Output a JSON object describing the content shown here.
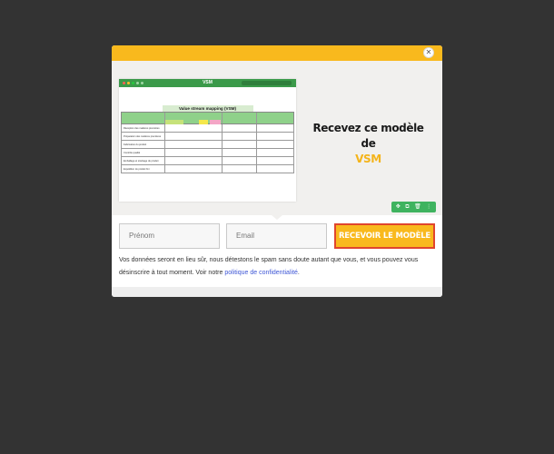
{
  "modal": {
    "close_symbol": "✕",
    "headline": "Recevez ce modèle de",
    "headline_accent": "VSM",
    "accent_color": "#f9b91d"
  },
  "preview": {
    "app_title": "VSM",
    "sheet_title": "Value stream mapping (VSM)",
    "rows": [
      "Réception des matières premières",
      "Préparation des matières premières",
      "Fabrication du produit",
      "Contrôle qualité",
      "Emballage et stockage du produit",
      "Expédition du produit fini"
    ]
  },
  "toolbar": {
    "icons": [
      "move-icon",
      "copy-icon",
      "delete-icon",
      "more-icon"
    ],
    "glyphs": [
      "✥",
      "⧉",
      "🗑",
      "⋮"
    ]
  },
  "form": {
    "firstname_placeholder": "Prénom",
    "email_placeholder": "Email",
    "submit_label": "RECEVOIR LE MODÈLE"
  },
  "disclaimer": {
    "text": "Vos données seront en lieu sûr, nous détestons le spam sans doute autant que vous, et vous pouvez vous désinscrire à tout moment. Voir notre ",
    "link_text": "politique de confidentialité",
    "end": "."
  }
}
